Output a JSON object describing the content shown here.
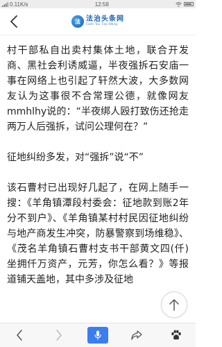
{
  "status_bar": {
    "network_speed": "0.11K/s",
    "time": "12:58",
    "icons": [
      "signal-icon",
      "wifi-icon",
      "battery-icon"
    ]
  },
  "header": {
    "logo_cn": "法治头条网",
    "logo_en": "Fazhi Tou Tiao Wang",
    "logo_mark": "法"
  },
  "article": {
    "paragraphs": [
      "村干部私自出卖村集体土地，联合开发商、黑社会利诱威逼，半夜强拆石安庙一事在网络上也引起了轩然大波，大多数网友认为这事很不合常理公德，就像网友mmhlhy说的：“半夜绑人殴打致伤还抢走两万人后强拆，试问公理何在？”",
      "征地纠纷多发，对“强拆”说“不”",
      "该石曹村已出现好几起了，在网上随手一搜：《羊角镇潭段村委会：征地款到账2年分不到户》、《羊角镇某村村民因征地纠纷与地产商发生冲突，防暴警察到场维稳》、《茂名羊角镇石曹村支书干部黄文四(仟)坐拥仟万资产，元芳，你怎么看？》等报道铺天盖地，其中多涉及征地"
    ]
  },
  "bottom_bar": {
    "items": [
      "back-icon",
      "forward-icon",
      "mic-icon",
      "share-icon",
      "paw-icon"
    ]
  },
  "colors": {
    "accent": "#3a7df0",
    "logo": "#1b64b8",
    "status_bar_bg": "#ededed",
    "text": "#222222"
  }
}
